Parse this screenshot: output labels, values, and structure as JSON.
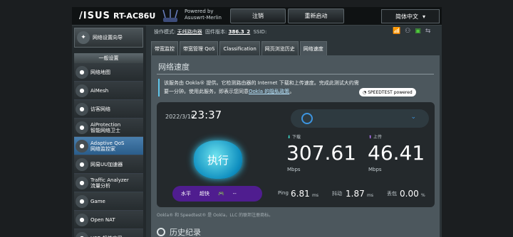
{
  "header": {
    "logo": "/ISUS",
    "model": "RT-AC86U",
    "merlin": [
      "Powered by",
      "Asuswrt-Merlin"
    ],
    "logout": "注销",
    "reboot": "重新启动",
    "language": "简体中文",
    "info": {
      "mode_label": "操作模式:",
      "mode_value": "无线路由器",
      "fw_label": "固件版本:",
      "fw_value": "386.3_2",
      "ssid_label": "SSID:"
    }
  },
  "sidebar": {
    "qis": "网络设置向导",
    "section": "一般设置",
    "items": [
      {
        "label": "网络地图",
        "icon": "network-map-icon"
      },
      {
        "label": "AiMesh",
        "icon": "aimesh-icon"
      },
      {
        "label": "访客网络",
        "icon": "guest-network-icon"
      },
      {
        "label": "AiProtection\n智能网络卫士",
        "icon": "shield-icon"
      },
      {
        "label": "Adaptive QoS\n网络监控家",
        "icon": "qos-icon",
        "active": true
      },
      {
        "label": "网易UU加速器",
        "icon": "uu-icon"
      },
      {
        "label": "Traffic Analyzer\n流量分析",
        "icon": "traffic-icon"
      },
      {
        "label": "Game",
        "icon": "gamepad-icon"
      },
      {
        "label": "Open NAT",
        "icon": "open-nat-icon"
      },
      {
        "label": "USB 相关应用",
        "icon": "usb-icon"
      }
    ]
  },
  "tabs": [
    "带宽监控",
    "带宽管理 QoS",
    "Classification",
    "网页浏览历史",
    "网络速度"
  ],
  "main": {
    "title": "网络速度",
    "desc_line1": "该服务由 Ookla® 提供。它检测路由器的 Internet 下载和上传速度。完成此测试大约需",
    "desc_line2": "要一分钟。使用此服务，即表示您同意",
    "desc_link": "Ookla 的隐私政策",
    "desc_end": "。",
    "brand": "SPEEDTEST powered",
    "date": "2022/3/10",
    "time": "23:37",
    "go": "执行",
    "download_label": "下载",
    "upload_label": "上传",
    "download": "307.61",
    "upload": "46.41",
    "unit": "Mbps",
    "level_label": "水平",
    "level_value": "超快",
    "level_dash": "--",
    "ping_label": "Ping",
    "ping": "6.81",
    "jitter_label": "抖动",
    "jitter": "1.87",
    "loss_label": "丢包",
    "loss": "0.00",
    "ms": "ms",
    "pct": "%",
    "footnote": "Ookla® 和 Speedtest® 是 Ookla，LLC 的联邦注册商标。",
    "history": "历史纪录"
  }
}
